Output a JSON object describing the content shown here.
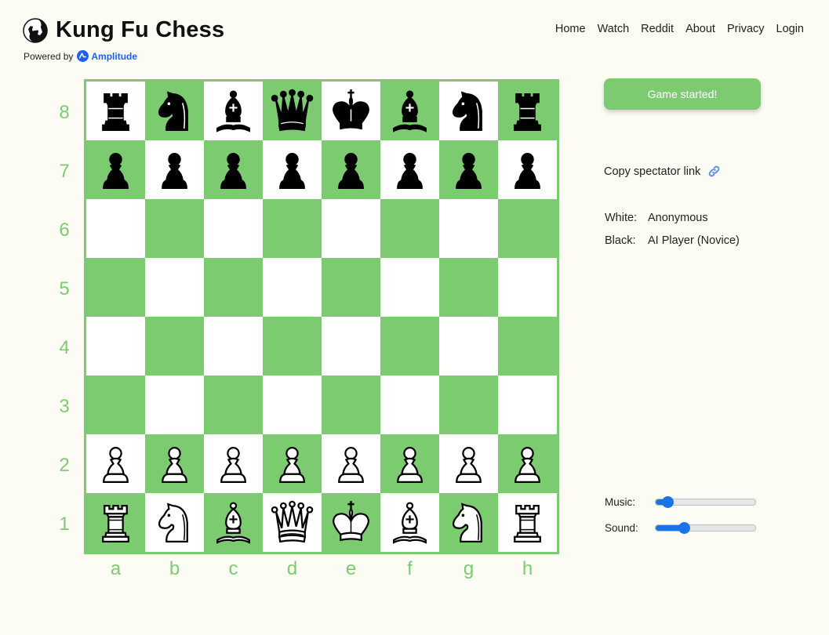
{
  "header": {
    "title": "Kung Fu Chess",
    "powered_by": "Powered by",
    "amplitude": "Amplitude",
    "logo_icon": "yin-yang-horse-icon"
  },
  "nav": [
    {
      "label": "Home"
    },
    {
      "label": "Watch"
    },
    {
      "label": "Reddit"
    },
    {
      "label": "About"
    },
    {
      "label": "Privacy"
    },
    {
      "label": "Login"
    }
  ],
  "board": {
    "ranks": [
      "8",
      "7",
      "6",
      "5",
      "4",
      "3",
      "2",
      "1"
    ],
    "files": [
      "a",
      "b",
      "c",
      "d",
      "e",
      "f",
      "g",
      "h"
    ],
    "colors": {
      "dark": "#7dcb71",
      "light": "#ffffff"
    },
    "position": [
      [
        "r",
        "n",
        "b",
        "q",
        "k",
        "b",
        "n",
        "r"
      ],
      [
        "p",
        "p",
        "p",
        "p",
        "p",
        "p",
        "p",
        "p"
      ],
      [
        "",
        "",
        "",
        "",
        "",
        "",
        "",
        ""
      ],
      [
        "",
        "",
        "",
        "",
        "",
        "",
        "",
        ""
      ],
      [
        "",
        "",
        "",
        "",
        "",
        "",
        "",
        ""
      ],
      [
        "",
        "",
        "",
        "",
        "",
        "",
        "",
        ""
      ],
      [
        "P",
        "P",
        "P",
        "P",
        "P",
        "P",
        "P",
        "P"
      ],
      [
        "R",
        "N",
        "B",
        "Q",
        "K",
        "B",
        "N",
        "R"
      ]
    ]
  },
  "game": {
    "start_button": "Game started!",
    "spectator_link": "Copy spectator link",
    "link_icon": "link-icon",
    "white_label": "White:",
    "white_player": "Anonymous",
    "black_label": "Black:",
    "black_player": "AI Player (Novice)"
  },
  "audio": {
    "music_label": "Music:",
    "music_level": 0.12,
    "sound_label": "Sound:",
    "sound_level": 0.28
  },
  "accent_color": "#7dcb71",
  "slider_color": "#1a73e8"
}
